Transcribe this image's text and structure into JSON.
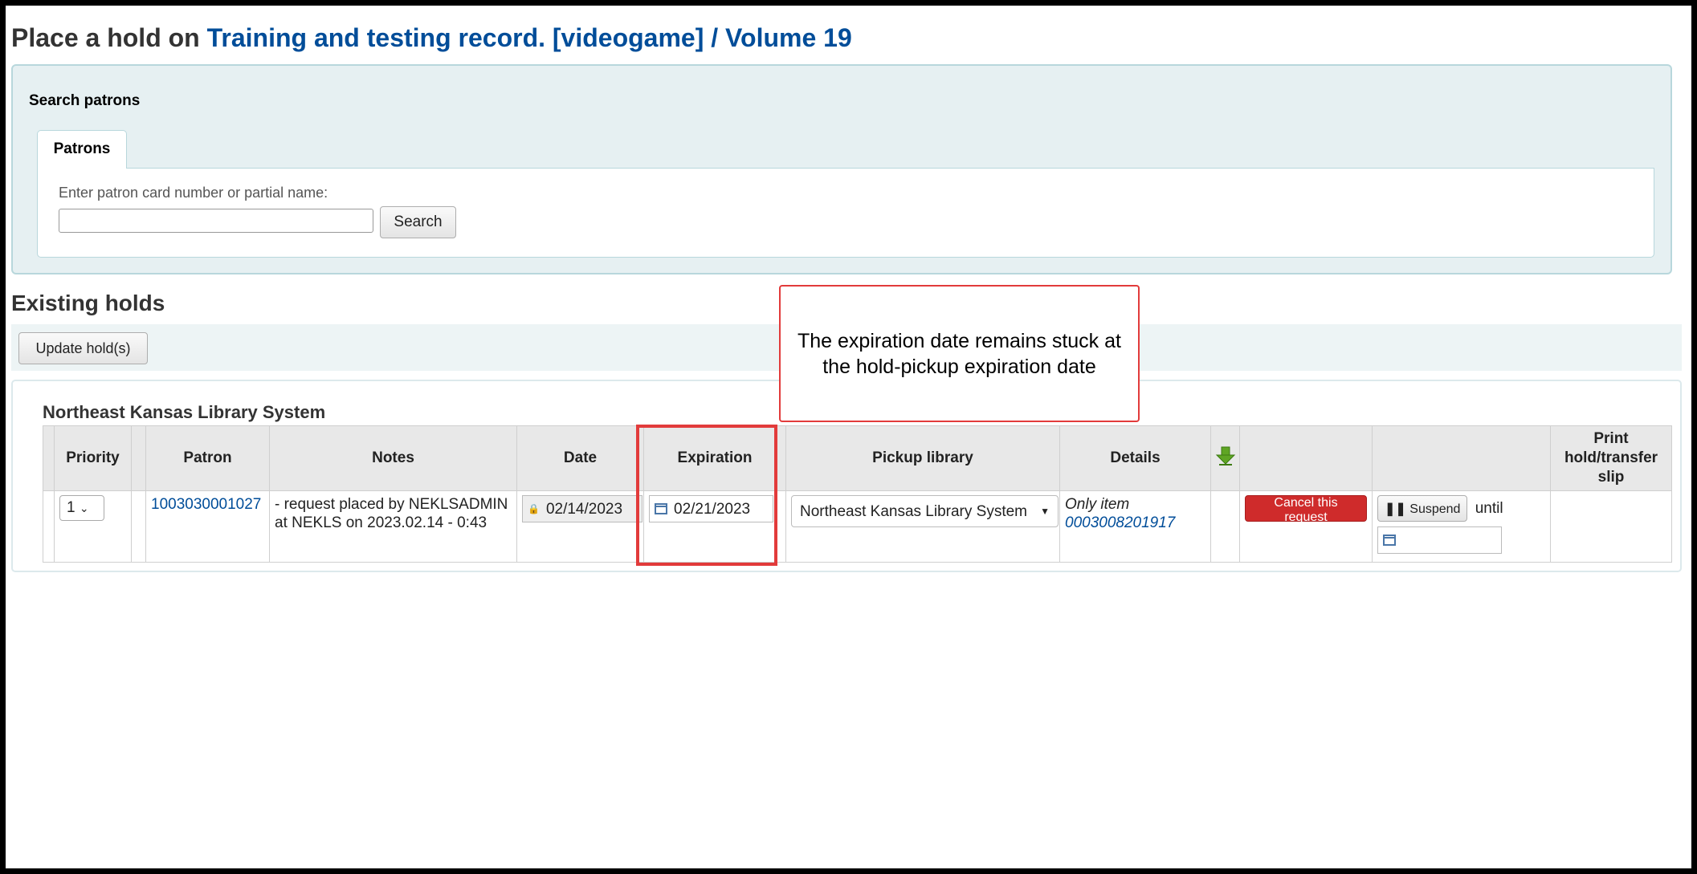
{
  "page": {
    "title_prefix": "Place a hold on ",
    "title_link": "Training and testing record. [videogame] / Volume 19"
  },
  "search": {
    "legend": "Search patrons",
    "tab_label": "Patrons",
    "input_label": "Enter patron card number or partial name:",
    "input_value": "",
    "button_label": "Search"
  },
  "existing": {
    "heading": "Existing holds",
    "update_button": "Update hold(s)",
    "branch": "Northeast Kansas Library System"
  },
  "table": {
    "headers": {
      "priority": "Priority",
      "patron": "Patron",
      "notes": "Notes",
      "date": "Date",
      "expiration": "Expiration",
      "pickup": "Pickup library",
      "details": "Details",
      "print": "Print hold/transfer slip"
    },
    "rows": [
      {
        "priority": "1",
        "patron": "1003030001027",
        "notes": "- request placed by NEKLSADMIN at NEKLS on 2023.02.14 - 0:43",
        "date": "02/14/2023",
        "expiration": "02/21/2023",
        "pickup": "Northeast Kansas Library System",
        "details_label": "Only item",
        "details_barcode": "0003008201917",
        "cancel_label": "Cancel this request",
        "suspend_label": "Suspend",
        "suspend_until": "until",
        "suspend_date": ""
      }
    ]
  },
  "annotation": {
    "callout_text": "The expiration date remains stuck at the hold-pickup expiration date",
    "color": "#e23b3b"
  },
  "icons": [
    "calendar-icon",
    "lock-icon",
    "chevron-down-icon",
    "down-arrow-icon",
    "pause-icon"
  ]
}
